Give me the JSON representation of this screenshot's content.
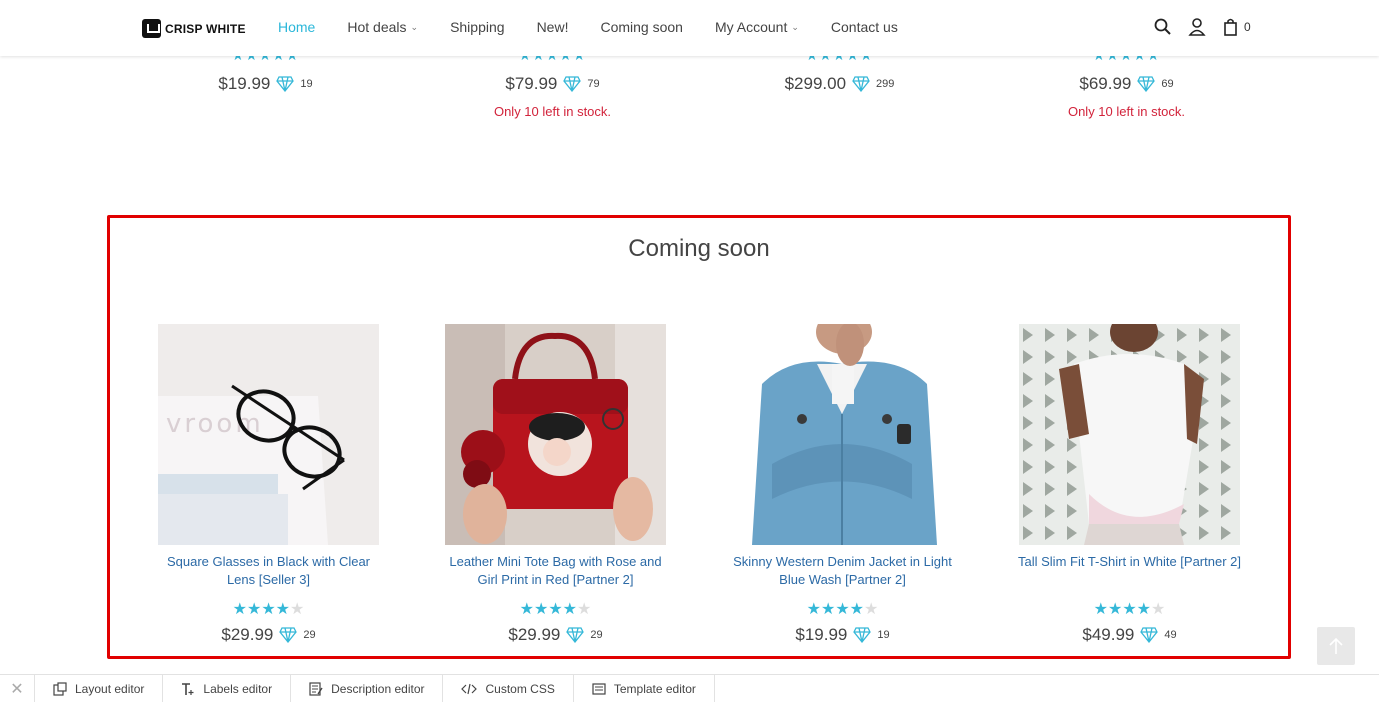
{
  "header": {
    "logo_text": "CRISP WHITE",
    "nav": [
      {
        "label": "Home",
        "active": true,
        "dropdown": false
      },
      {
        "label": "Hot deals",
        "active": false,
        "dropdown": true
      },
      {
        "label": "Shipping",
        "active": false,
        "dropdown": false
      },
      {
        "label": "New!",
        "active": false,
        "dropdown": false
      },
      {
        "label": "Coming soon",
        "active": false,
        "dropdown": false
      },
      {
        "label": "My Account",
        "active": false,
        "dropdown": true
      },
      {
        "label": "Contact us",
        "active": false,
        "dropdown": false
      }
    ],
    "cart_count": "0",
    "icons": [
      "search-icon",
      "user-icon",
      "cart-icon"
    ]
  },
  "top_products": [
    {
      "price": "$19.99",
      "points": "19",
      "stock": ""
    },
    {
      "price": "$79.99",
      "points": "79",
      "stock": "Only 10 left in stock."
    },
    {
      "price": "$299.00",
      "points": "299",
      "stock": ""
    },
    {
      "price": "$69.99",
      "points": "69",
      "stock": "Only 10 left in stock."
    }
  ],
  "coming_soon": {
    "title": "Coming soon",
    "products": [
      {
        "name": "Square Glasses in Black with Clear Lens [Seller 3]",
        "rating": 4,
        "price": "$29.99",
        "points": "29",
        "image": "glasses-on-magazine"
      },
      {
        "name": "Leather Mini Tote Bag with Rose and Girl Print in Red [Partner 2]",
        "rating": 4,
        "price": "$29.99",
        "points": "29",
        "image": "red-handbag"
      },
      {
        "name": "Skinny Western Denim Jacket in Light Blue Wash [Partner 2]",
        "rating": 4,
        "price": "$19.99",
        "points": "19",
        "image": "denim-jacket"
      },
      {
        "name": "Tall Slim Fit T-Shirt in White [Partner 2]",
        "rating": 4,
        "price": "$49.99",
        "points": "49",
        "image": "white-tshirt"
      }
    ]
  },
  "editor_bar": {
    "items": [
      {
        "label": "Layout editor",
        "icon": "layout-icon"
      },
      {
        "label": "Labels editor",
        "icon": "text-icon"
      },
      {
        "label": "Description editor",
        "icon": "description-icon"
      },
      {
        "label": "Custom CSS",
        "icon": "code-icon"
      },
      {
        "label": "Template editor",
        "icon": "template-icon"
      }
    ]
  },
  "colors": {
    "accent": "#2bb7d9",
    "stock_warning": "#d2233b",
    "link": "#2c6aa6",
    "highlight_border": "#e10000"
  }
}
